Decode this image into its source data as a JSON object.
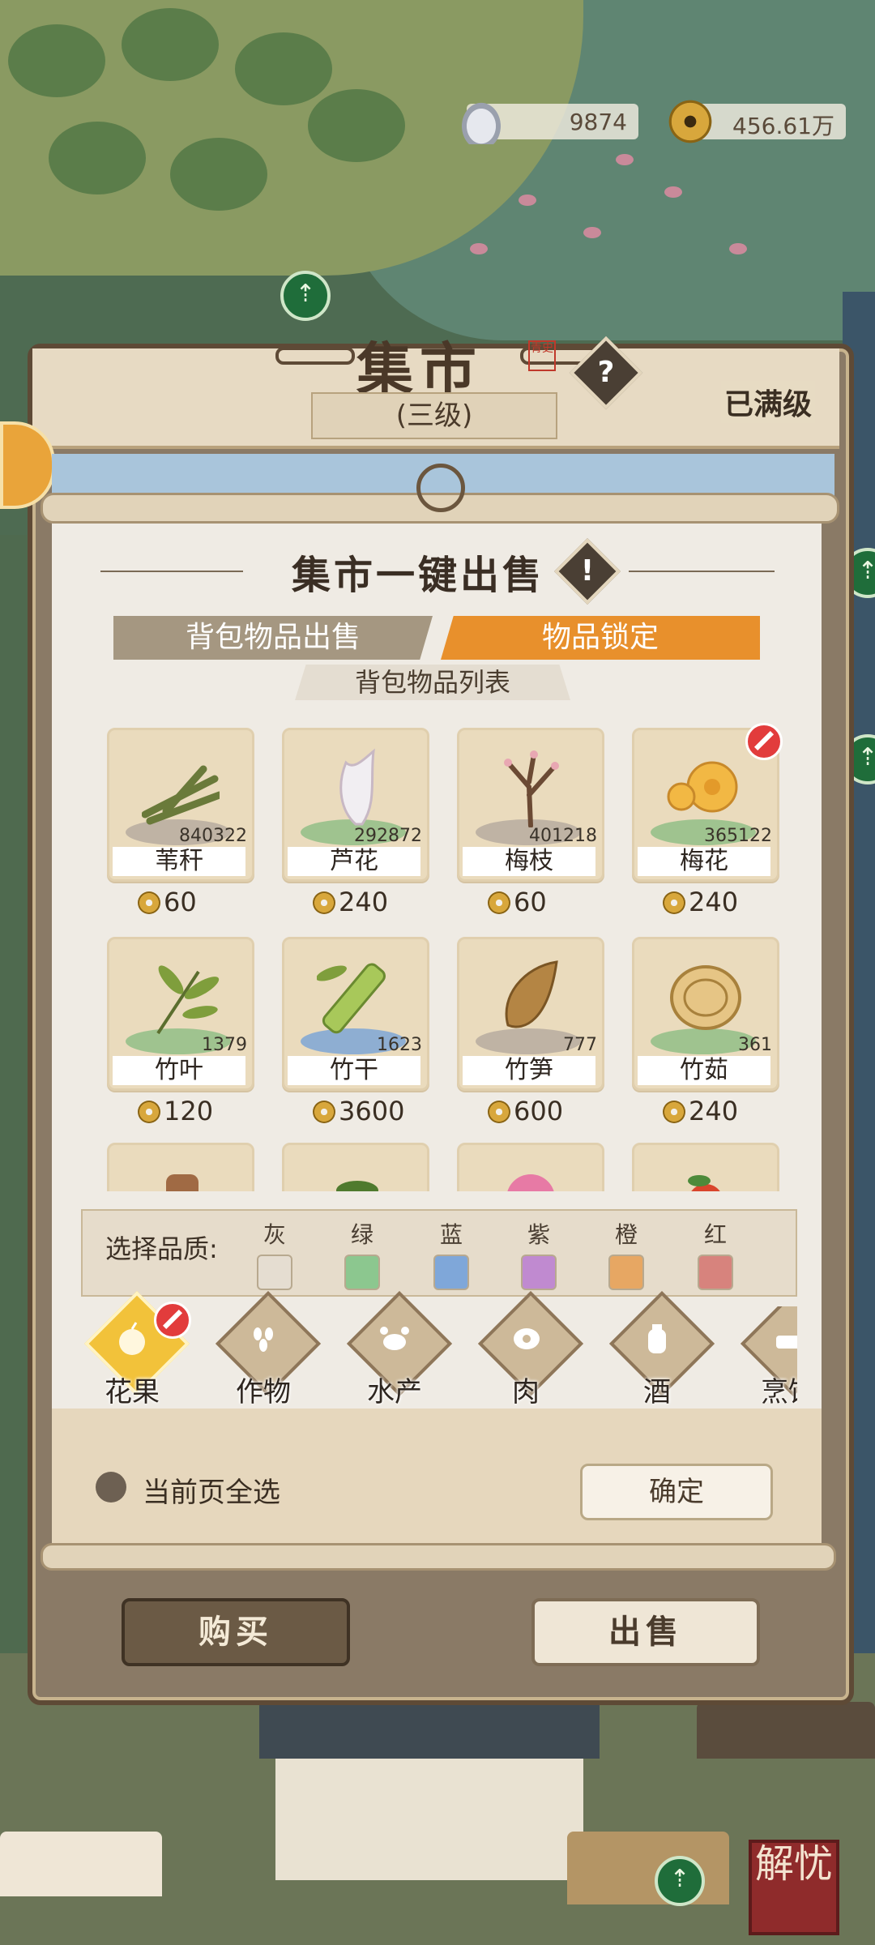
{
  "currency": {
    "silver": "9874",
    "coins": "456.61万"
  },
  "market": {
    "title": "集市",
    "seal": "青史",
    "level": "(三级)",
    "full_level": "已满级",
    "help_glyph": "?"
  },
  "panel": {
    "title": "集市一键出售",
    "info_glyph": "!",
    "tabs": [
      "背包物品出售",
      "物品锁定"
    ],
    "active_tab": 1,
    "list_title": "背包物品列表",
    "items": [
      {
        "name": "苇秆",
        "qty": "840322",
        "price": "60",
        "locked": false
      },
      {
        "name": "芦花",
        "qty": "292872",
        "price": "240",
        "locked": false
      },
      {
        "name": "梅枝",
        "qty": "401218",
        "price": "60",
        "locked": false
      },
      {
        "name": "梅花",
        "qty": "365122",
        "price": "240",
        "locked": true
      },
      {
        "name": "竹叶",
        "qty": "1379",
        "price": "120",
        "locked": false
      },
      {
        "name": "竹干",
        "qty": "1623",
        "price": "3600",
        "locked": false
      },
      {
        "name": "竹笋",
        "qty": "777",
        "price": "600",
        "locked": false
      },
      {
        "name": "竹茹",
        "qty": "361",
        "price": "240",
        "locked": false
      }
    ]
  },
  "quality": {
    "label": "选择品质:",
    "options": [
      {
        "name": "灰",
        "color": "#e5ddd1"
      },
      {
        "name": "绿",
        "color": "#8cc78f"
      },
      {
        "name": "蓝",
        "color": "#7fa7d9"
      },
      {
        "name": "紫",
        "color": "#c08ad0"
      },
      {
        "name": "橙",
        "color": "#e7a763"
      },
      {
        "name": "红",
        "color": "#d7837d"
      }
    ]
  },
  "categories": {
    "items": [
      "花果",
      "作物",
      "水产",
      "肉",
      "酒",
      "烹饪"
    ],
    "active": 0
  },
  "footer": {
    "select_all": "当前页全选",
    "confirm": "确定",
    "buy": "购买",
    "sell": "出售"
  },
  "stamp": "解忧",
  "colors": {
    "accent": "#e8902c",
    "tab_inactive": "#a59781",
    "lock": "#e23c3c"
  }
}
